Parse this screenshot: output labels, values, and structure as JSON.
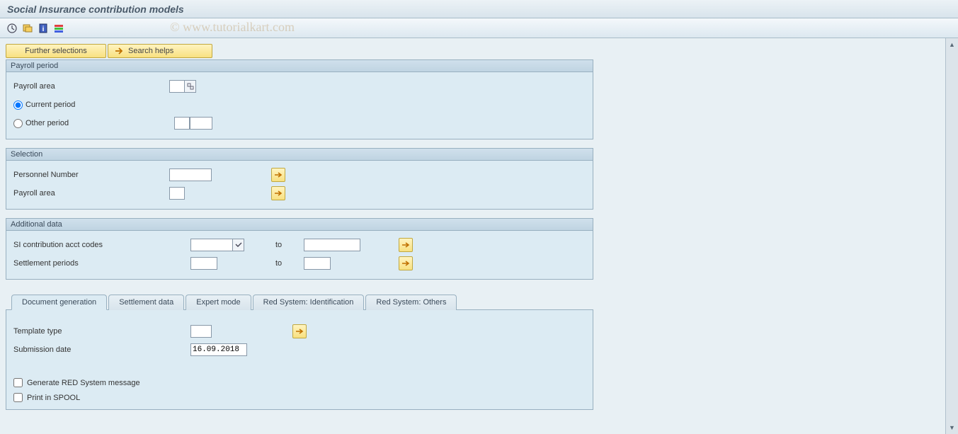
{
  "title": "Social Insurance contribution models",
  "watermark": "© www.tutorialkart.com",
  "topButtons": {
    "further": "Further selections",
    "search": "Search helps"
  },
  "groups": {
    "payroll": {
      "title": "Payroll period",
      "area_label": "Payroll area",
      "current": "Current period",
      "other": "Other period"
    },
    "selection": {
      "title": "Selection",
      "pernr": "Personnel Number",
      "area": "Payroll area"
    },
    "additional": {
      "title": "Additional data",
      "si_codes": "SI contribution acct codes",
      "settle": "Settlement periods",
      "to": "to"
    }
  },
  "tabs": {
    "docgen": "Document generation",
    "settle": "Settlement data",
    "expert": "Expert mode",
    "redid": "Red System: Identification",
    "redoth": "Red System: Others"
  },
  "docgen": {
    "template": "Template type",
    "subdate_label": "Submission date",
    "subdate_value": "16.09.2018",
    "gen_red": "Generate RED System message",
    "print_spool": "Print in SPOOL"
  }
}
